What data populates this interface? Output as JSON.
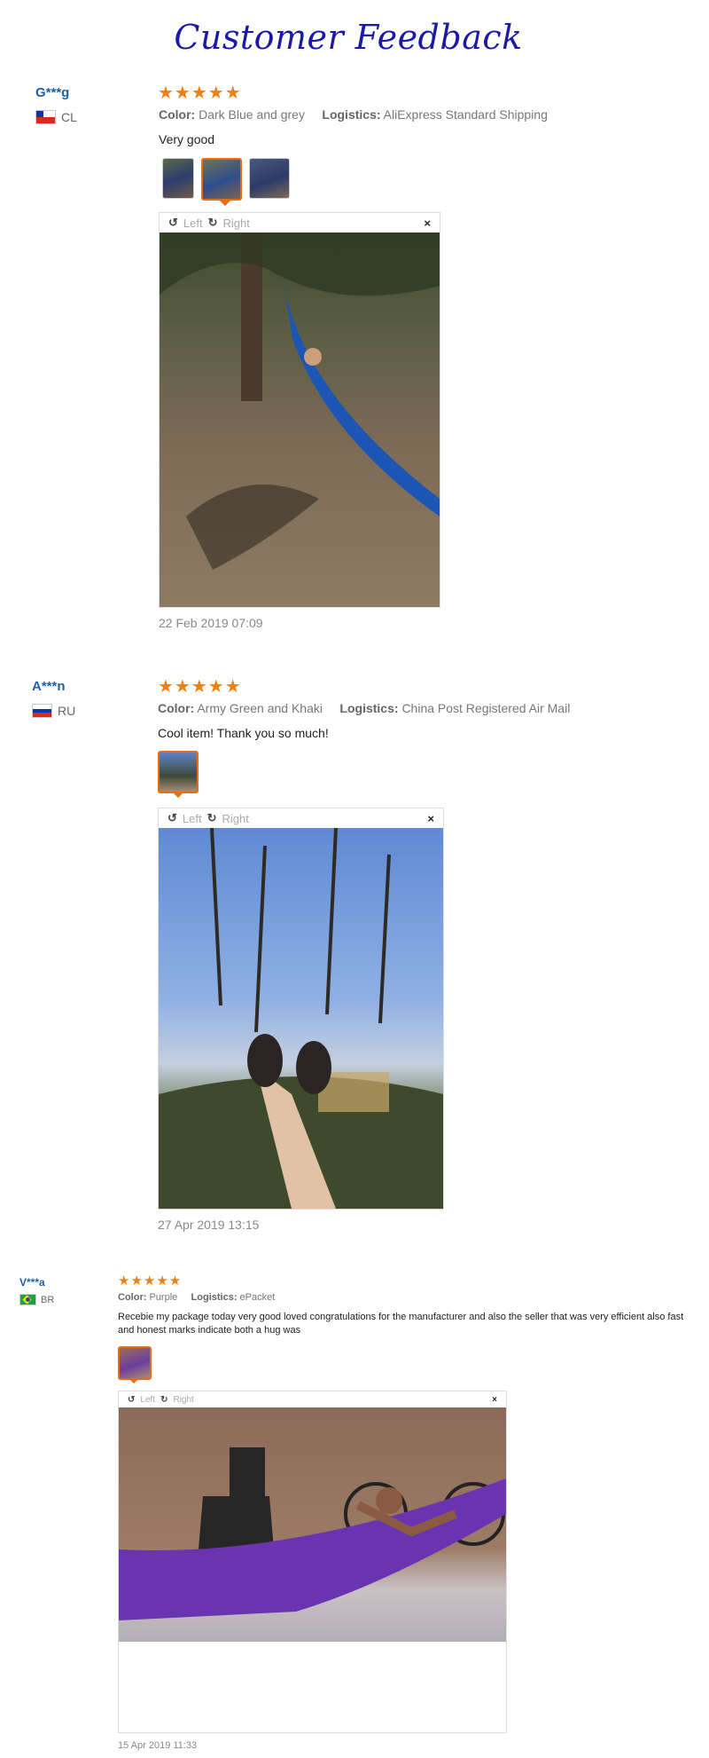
{
  "page": {
    "title": "Customer Feedback"
  },
  "colors": {
    "title": "#1a19a8",
    "user": "#1f5fa8",
    "star": "#f07f12",
    "selected": "#e86b15"
  },
  "viewer_labels": {
    "left": "Left",
    "right": "Right",
    "close": "×",
    "rotate_left_icon": "↺",
    "rotate_right_icon": "↻"
  },
  "reviews": [
    {
      "user": "G***g",
      "country": "CL",
      "flag": "chile-flag-icon",
      "stars": "★★★★★",
      "rating": 5,
      "color_label": "Color:",
      "color_value": "Dark Blue and grey",
      "logistics_label": "Logistics:",
      "logistics_value": "AliExpress Standard Shipping",
      "comment": "Very good",
      "photos_count": 3,
      "selected_photo": 2,
      "date": "22 Feb 2019 07:09"
    },
    {
      "user": "A***n",
      "country": "RU",
      "flag": "russia-flag-icon",
      "stars": "★★★★★",
      "rating": 5,
      "color_label": "Color:",
      "color_value": "Army Green and Khaki",
      "logistics_label": "Logistics:",
      "logistics_value": "China Post Registered Air Mail",
      "comment": "Cool item! Thank you so much!",
      "photos_count": 1,
      "selected_photo": 1,
      "date": "27 Apr 2019 13:15"
    },
    {
      "user": "V***a",
      "country": "BR",
      "flag": "brazil-flag-icon",
      "stars": "★★★★★",
      "rating": 5,
      "color_label": "Color:",
      "color_value": "Purple",
      "logistics_label": "Logistics:",
      "logistics_value": "ePacket",
      "comment": "Recebie my package today very good loved congratulations for the manufacturer and also the seller that was very efficient also fast and honest marks indicate both a hug was",
      "photos_count": 1,
      "selected_photo": 1,
      "date": "15 Apr 2019 11:33"
    }
  ]
}
